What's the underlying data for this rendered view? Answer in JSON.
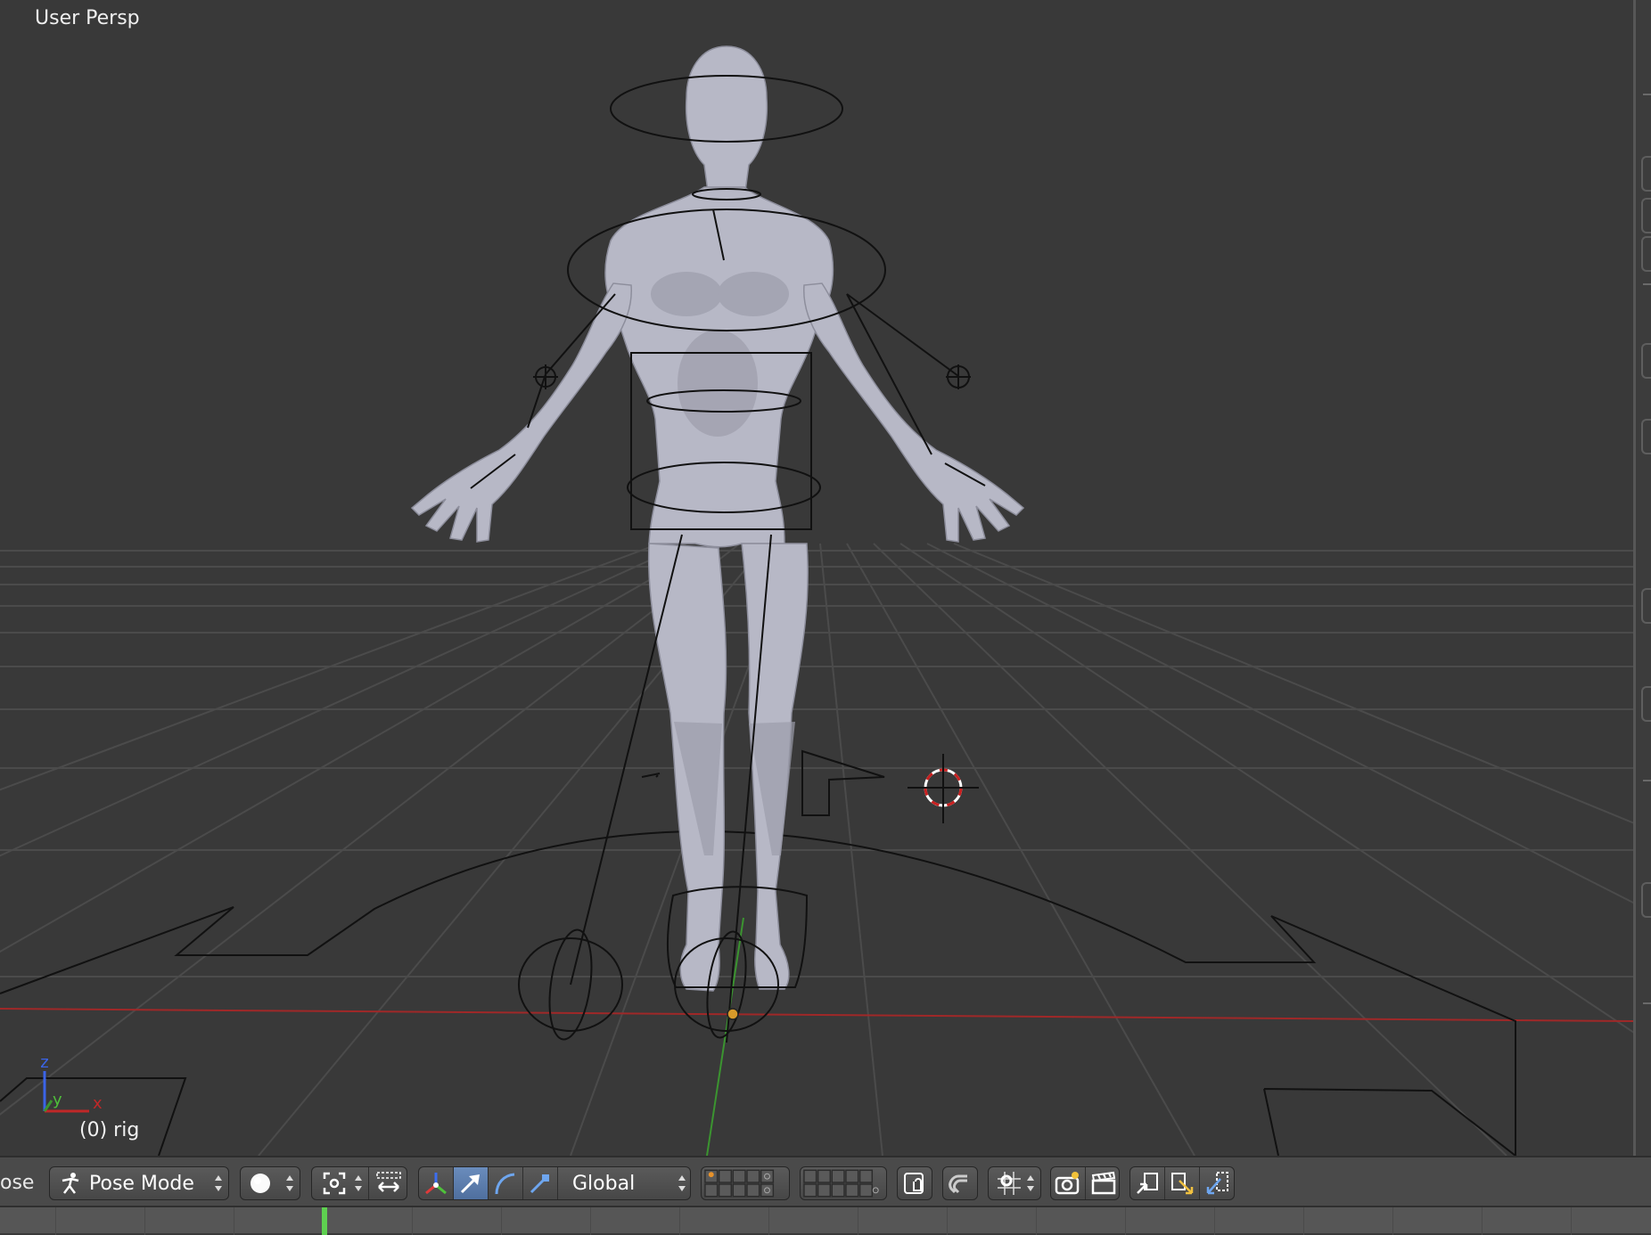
{
  "viewport": {
    "view_label": "User Persp",
    "object_label": "(0) rig",
    "axis_labels": {
      "z": "z",
      "y": "y",
      "x": "x"
    }
  },
  "header": {
    "mode_prefix": "ose",
    "mode_select": "Pose Mode",
    "transform_orientation": "Global"
  },
  "colors": {
    "viewport_bg": "#393939",
    "grid_line": "#4c4c4c",
    "x_axis": "#a82a2a",
    "y_axis": "#3f9a2c",
    "highlight_button": "#5c7fb4",
    "playhead": "#5ed050",
    "mesh": "#b9bac8"
  },
  "icons": [
    "pose-mode-icon",
    "shading-sphere-icon",
    "pivot-icon",
    "manipulator-icon",
    "translate-arrow-icon",
    "rotate-arc-icon",
    "scale-icon",
    "layer-grid",
    "lock-camera-icon",
    "snap-magnet-icon",
    "snap-target-icon",
    "render-camera-icon",
    "clapboard-icon",
    "copy-pose-icon",
    "paste-pose-icon",
    "paste-flipped-icon"
  ]
}
